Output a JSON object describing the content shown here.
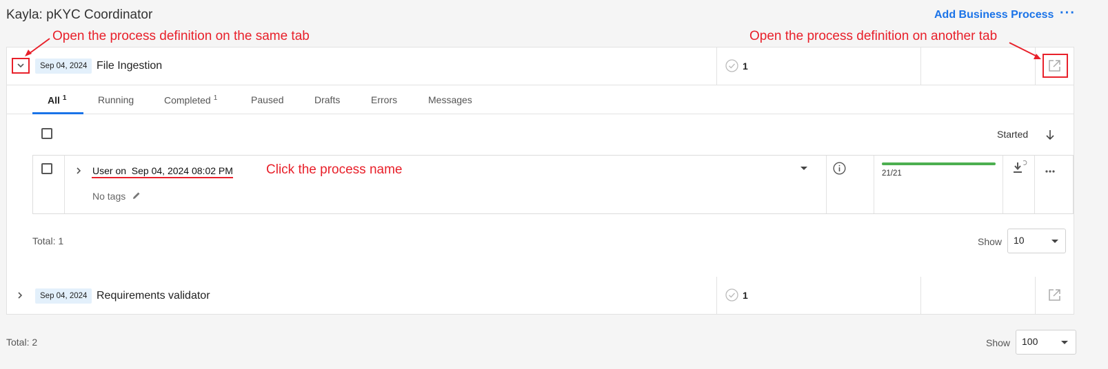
{
  "header": {
    "title": "Kayla: pKYC Coordinator",
    "add_label": "Add Business Process",
    "more_label": "···"
  },
  "annotations": {
    "same_tab": "Open the process definition on the same tab",
    "other_tab": "Open the process definition on another tab",
    "click_name": "Click the process name"
  },
  "processes": [
    {
      "date": "Sep 04, 2024",
      "name": "File Ingestion",
      "count": "1"
    },
    {
      "date": "Sep 04, 2024",
      "name": "Requirements validator",
      "count": "1"
    }
  ],
  "tabs": [
    {
      "label": "All",
      "badge": "1"
    },
    {
      "label": "Running",
      "badge": ""
    },
    {
      "label": "Completed",
      "badge": "1"
    },
    {
      "label": "Paused",
      "badge": ""
    },
    {
      "label": "Drafts",
      "badge": ""
    },
    {
      "label": "Errors",
      "badge": ""
    },
    {
      "label": "Messages",
      "badge": ""
    }
  ],
  "list": {
    "sort_label": "Started",
    "instance_name": "User on  Sep 04, 2024 08:02 PM",
    "tags_label": "No tags",
    "progress_text": "21/21",
    "progress": 1.0,
    "total_label": "Total: 1",
    "show_label": "Show",
    "show_value": "10"
  },
  "footer": {
    "total_label": "Total: 2",
    "show_label": "Show",
    "show_value": "100"
  },
  "colors": {
    "accent": "#1a73e8",
    "annotation": "#e8202a",
    "progress": "#4caf50"
  }
}
